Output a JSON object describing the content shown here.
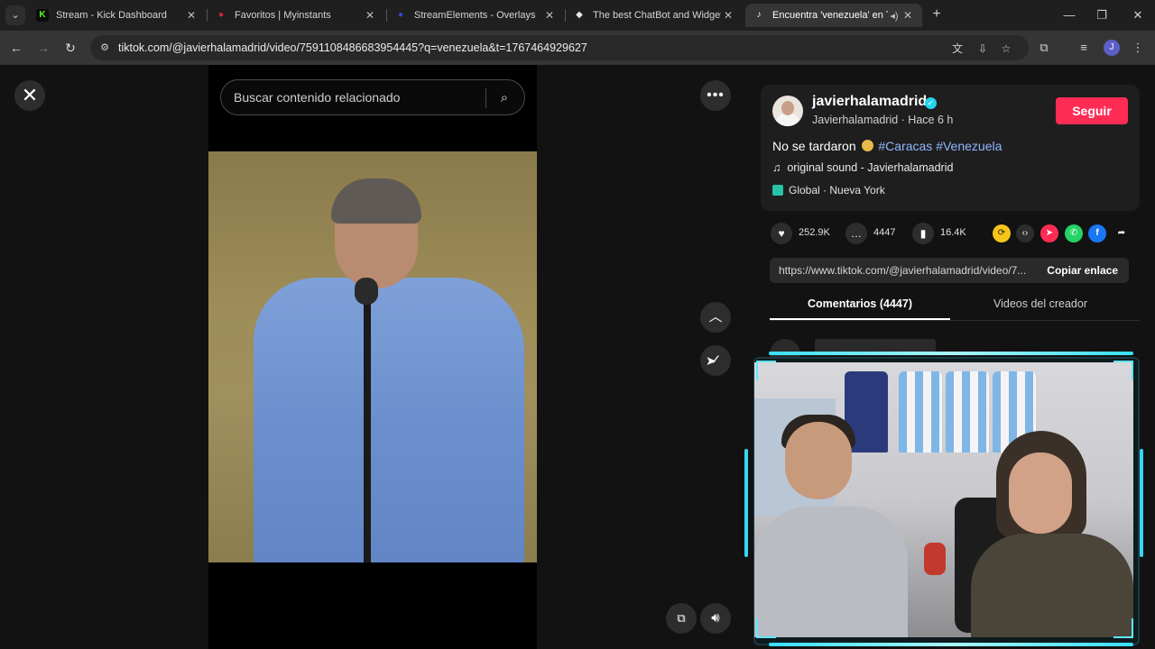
{
  "browser": {
    "tabs": [
      {
        "title": "Stream - Kick Dashboard",
        "favicon": "K",
        "color": "#53fc18"
      },
      {
        "title": "Favoritos | Myinstants",
        "favicon": "●",
        "color": "#d6232f"
      },
      {
        "title": "StreamElements - Overlays",
        "favicon": "●",
        "color": "#3a46d6"
      },
      {
        "title": "The best ChatBot and Widgets",
        "favicon": "◆",
        "color": "#e8e8e8"
      },
      {
        "title": "Encuentra 'venezuela' en Tik",
        "favicon": "♪",
        "color": "#ffffff"
      }
    ],
    "url": "tiktok.com/@javierhalamadrid/video/7591108486683954445?q=venezuela&t=1767464929627",
    "profile_initial": "J"
  },
  "video": {
    "search_placeholder": "Buscar contenido relacionado"
  },
  "post": {
    "username": "javierhalamadrid",
    "display_name": "Javierhalamadrid",
    "time_ago": "Hace 6 h",
    "follow_label": "Seguir",
    "caption_text": "No se tardaron",
    "hashtag_1": "#Caracas",
    "hashtag_2": "#Venezuela",
    "sound": "original sound - Javierhalamadrid",
    "location": "Global · Nueva York",
    "likes": "252.9K",
    "comments": "4447",
    "saves": "16.4K",
    "link": "https://www.tiktok.com/@javierhalamadrid/video/7...",
    "copy_label": "Copiar enlace",
    "tab_comments": "Comentarios (4447)",
    "tab_creator": "Videos del creador"
  },
  "colors": {
    "accent": "#fe2c55",
    "hashtag": "#8fb8ff",
    "verified": "#20d5ec",
    "neon": "#35e0ff"
  }
}
